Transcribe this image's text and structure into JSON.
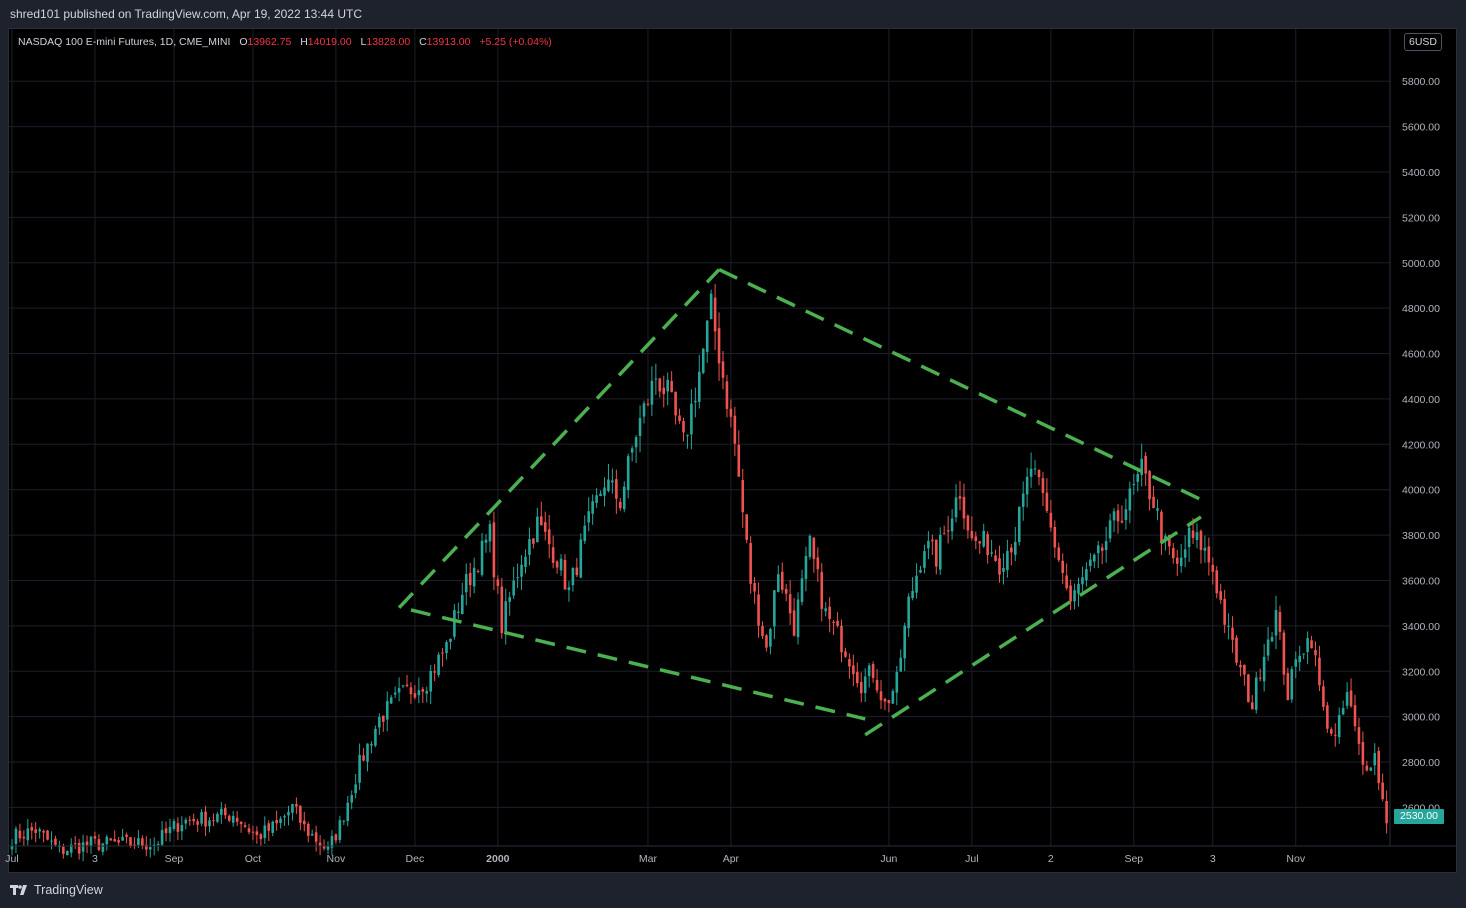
{
  "header": {
    "publish_info": "shred101 published on TradingView.com, Apr 19, 2022 13:44 UTC"
  },
  "legend": {
    "symbol": "NASDAQ 100 E-mini Futures, 1D, CME_MINI",
    "open_label": "O",
    "open": "13962.75",
    "high_label": "H",
    "high": "14019.00",
    "low_label": "L",
    "low": "13828.00",
    "close_label": "C",
    "close": "13913.00",
    "change": "+5.25 (+0.04%)"
  },
  "price_axis": {
    "currency": "USD",
    "top_cut_label": "6",
    "last_price": "2530.00"
  },
  "footer": {
    "brand": "TradingView"
  },
  "colors": {
    "background": "#000000",
    "grid": "#1c1f28",
    "up": "#26a69a",
    "down": "#ef5350",
    "pattern": "#4caf50",
    "axis_text": "#b2b5be"
  },
  "chart_data": {
    "type": "candlestick",
    "title": "NASDAQ 100 E-mini Futures, 1D, CME_MINI",
    "ylim": [
      2430,
      6030
    ],
    "y_ticks": [
      2600,
      2800,
      3000,
      3200,
      3400,
      3600,
      3800,
      4000,
      4200,
      4400,
      4600,
      4800,
      5000,
      5200,
      5400,
      5600,
      5800
    ],
    "y_tick_labels": [
      "2600.00",
      "2800.00",
      "3000.00",
      "3200.00",
      "3400.00",
      "3600.00",
      "3800.00",
      "4000.00",
      "4200.00",
      "4400.00",
      "4600.00",
      "4800.00",
      "5000.00",
      "5200.00",
      "5400.00",
      "5600.00",
      "5800.00"
    ],
    "x_ticks": [
      {
        "label": "Jul",
        "bar": 0,
        "bold": false
      },
      {
        "label": "3",
        "bar": 21,
        "bold": false
      },
      {
        "label": "Sep",
        "bar": 41,
        "bold": false
      },
      {
        "label": "Oct",
        "bar": 61,
        "bold": false
      },
      {
        "label": "Nov",
        "bar": 82,
        "bold": false
      },
      {
        "label": "Dec",
        "bar": 102,
        "bold": false
      },
      {
        "label": "2000",
        "bar": 123,
        "bold": true
      },
      {
        "label": "Mar",
        "bar": 161,
        "bold": false
      },
      {
        "label": "Apr",
        "bar": 182,
        "bold": false
      },
      {
        "label": "Jun",
        "bar": 222,
        "bold": false
      },
      {
        "label": "Jul",
        "bar": 243,
        "bold": false
      },
      {
        "label": "2",
        "bar": 263,
        "bold": false
      },
      {
        "label": "Sep",
        "bar": 284,
        "bold": false
      },
      {
        "label": "3",
        "bar": 304,
        "bold": false
      },
      {
        "label": "Nov",
        "bar": 325,
        "bold": false
      }
    ],
    "price_keyframes": [
      [
        0,
        2470
      ],
      [
        6,
        2500
      ],
      [
        12,
        2410
      ],
      [
        20,
        2440
      ],
      [
        36,
        2440
      ],
      [
        43,
        2540
      ],
      [
        49,
        2550
      ],
      [
        56,
        2570
      ],
      [
        62,
        2470
      ],
      [
        67,
        2520
      ],
      [
        71,
        2600
      ],
      [
        74,
        2510
      ],
      [
        80,
        2410
      ],
      [
        83,
        2520
      ],
      [
        88,
        2790
      ],
      [
        93,
        2990
      ],
      [
        98,
        3090
      ],
      [
        105,
        3160
      ],
      [
        110,
        3310
      ],
      [
        114,
        3550
      ],
      [
        121,
        3800
      ],
      [
        124,
        3400
      ],
      [
        129,
        3700
      ],
      [
        133,
        3850
      ],
      [
        138,
        3700
      ],
      [
        141,
        3550
      ],
      [
        145,
        3800
      ],
      [
        150,
        4040
      ],
      [
        154,
        3950
      ],
      [
        158,
        4250
      ],
      [
        163,
        4500
      ],
      [
        166,
        4420
      ],
      [
        170,
        4200
      ],
      [
        174,
        4520
      ],
      [
        177,
        4800
      ],
      [
        180,
        4500
      ],
      [
        183,
        4200
      ],
      [
        187,
        3600
      ],
      [
        191,
        3300
      ],
      [
        194,
        3650
      ],
      [
        198,
        3400
      ],
      [
        202,
        3750
      ],
      [
        206,
        3450
      ],
      [
        211,
        3300
      ],
      [
        215,
        3150
      ],
      [
        218,
        3200
      ],
      [
        221,
        3050
      ],
      [
        224,
        3150
      ],
      [
        227,
        3500
      ],
      [
        231,
        3760
      ],
      [
        234,
        3700
      ],
      [
        237,
        3860
      ],
      [
        240,
        4000
      ],
      [
        243,
        3770
      ],
      [
        247,
        3760
      ],
      [
        250,
        3680
      ],
      [
        254,
        3800
      ],
      [
        258,
        4100
      ],
      [
        261,
        3950
      ],
      [
        265,
        3700
      ],
      [
        268,
        3500
      ],
      [
        271,
        3600
      ],
      [
        275,
        3700
      ],
      [
        279,
        3850
      ],
      [
        283,
        3960
      ],
      [
        286,
        4080
      ],
      [
        289,
        3950
      ],
      [
        292,
        3750
      ],
      [
        295,
        3650
      ],
      [
        298,
        3790
      ],
      [
        301,
        3760
      ],
      [
        304,
        3650
      ],
      [
        308,
        3360
      ],
      [
        311,
        3200
      ],
      [
        314,
        3050
      ],
      [
        317,
        3300
      ],
      [
        320,
        3450
      ],
      [
        323,
        3100
      ],
      [
        326,
        3300
      ],
      [
        329,
        3350
      ],
      [
        332,
        3020
      ],
      [
        335,
        2900
      ],
      [
        338,
        3100
      ],
      [
        342,
        2780
      ],
      [
        345,
        2830
      ],
      [
        348,
        2530
      ]
    ],
    "trendlines": [
      {
        "from": [
          98,
          3480
        ],
        "to": [
          179,
          4970
        ]
      },
      {
        "from": [
          179,
          4970
        ],
        "to": [
          303,
          3940
        ]
      },
      {
        "from": [
          101,
          3470
        ],
        "to": [
          216,
          2990
        ]
      },
      {
        "from": [
          216,
          2920
        ],
        "to": [
          301,
          3880
        ]
      }
    ]
  }
}
